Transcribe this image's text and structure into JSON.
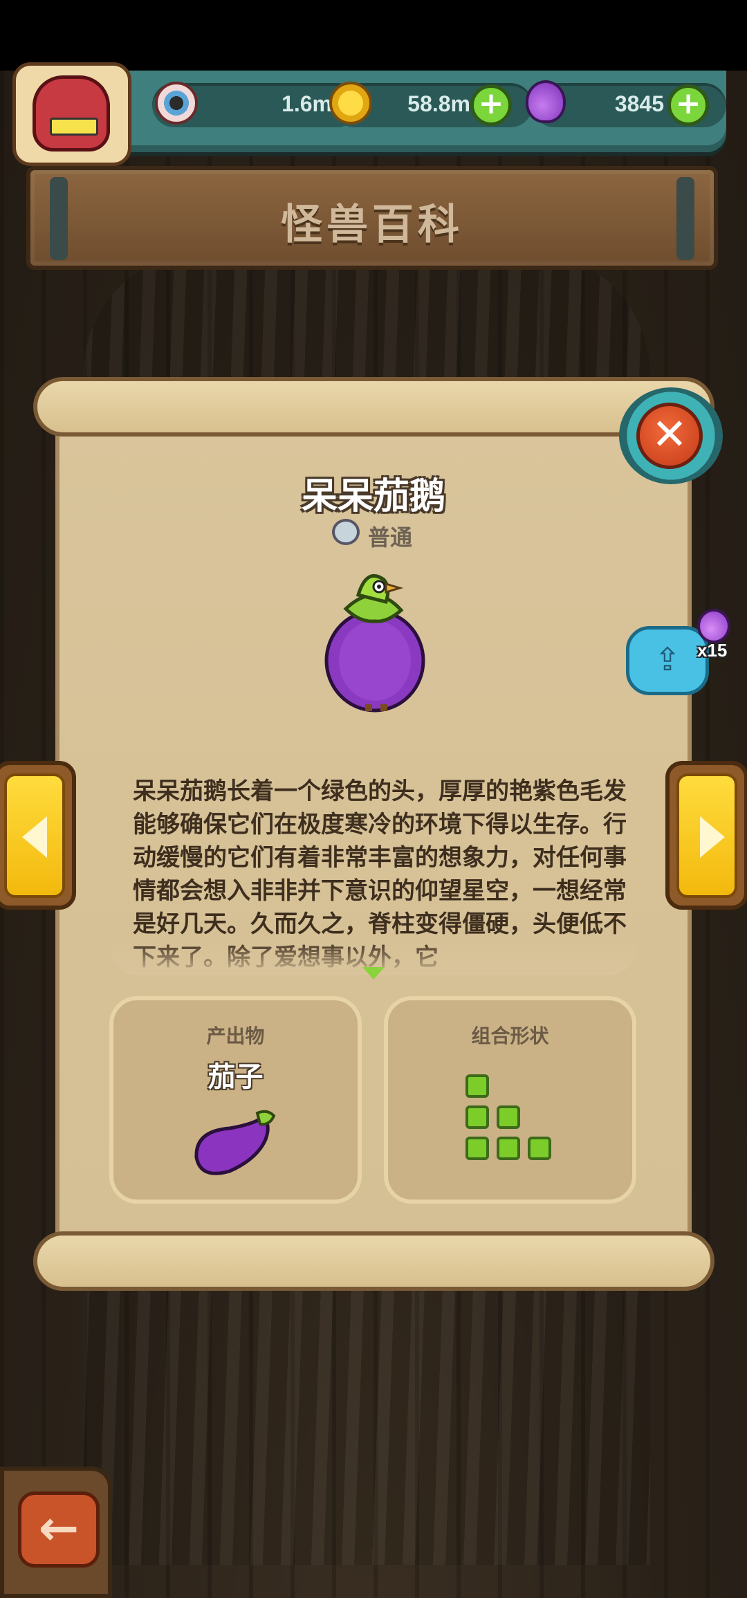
{
  "header": {
    "title": "怪兽百科",
    "currencies": {
      "eyes": "1.6m",
      "gold": "58.8m",
      "potion": "3845"
    },
    "plus_label": "+"
  },
  "monster": {
    "name": "呆呆茄鹅",
    "rarity": "普通",
    "description": "呆呆茄鹅长着一个绿色的头，厚厚的艳紫色毛发能够确保它们在极度寒冷的环境下得以生存。行动缓慢的它们有着非常丰富的想象力，对任何事情都会想入非非并下意识的仰望星空，一想经常是好几天。久而久之，脊柱变得僵硬，头便低不下来了。除了爱想事以外，它"
  },
  "product": {
    "label": "产出物",
    "name": "茄子"
  },
  "shape": {
    "label": "组合形状",
    "cells": [
      [
        0,
        0
      ],
      [
        0,
        1
      ],
      [
        1,
        1
      ],
      [
        0,
        2
      ],
      [
        1,
        2
      ],
      [
        2,
        2
      ]
    ]
  },
  "share": {
    "count": "x15"
  },
  "buttons": {
    "close": "✕",
    "back": "←"
  },
  "colors": {
    "accent_green": "#7ccc2a",
    "monster_purple": "#8a3ac0",
    "close_red": "#e0532b",
    "share_blue": "#49c1e4"
  }
}
